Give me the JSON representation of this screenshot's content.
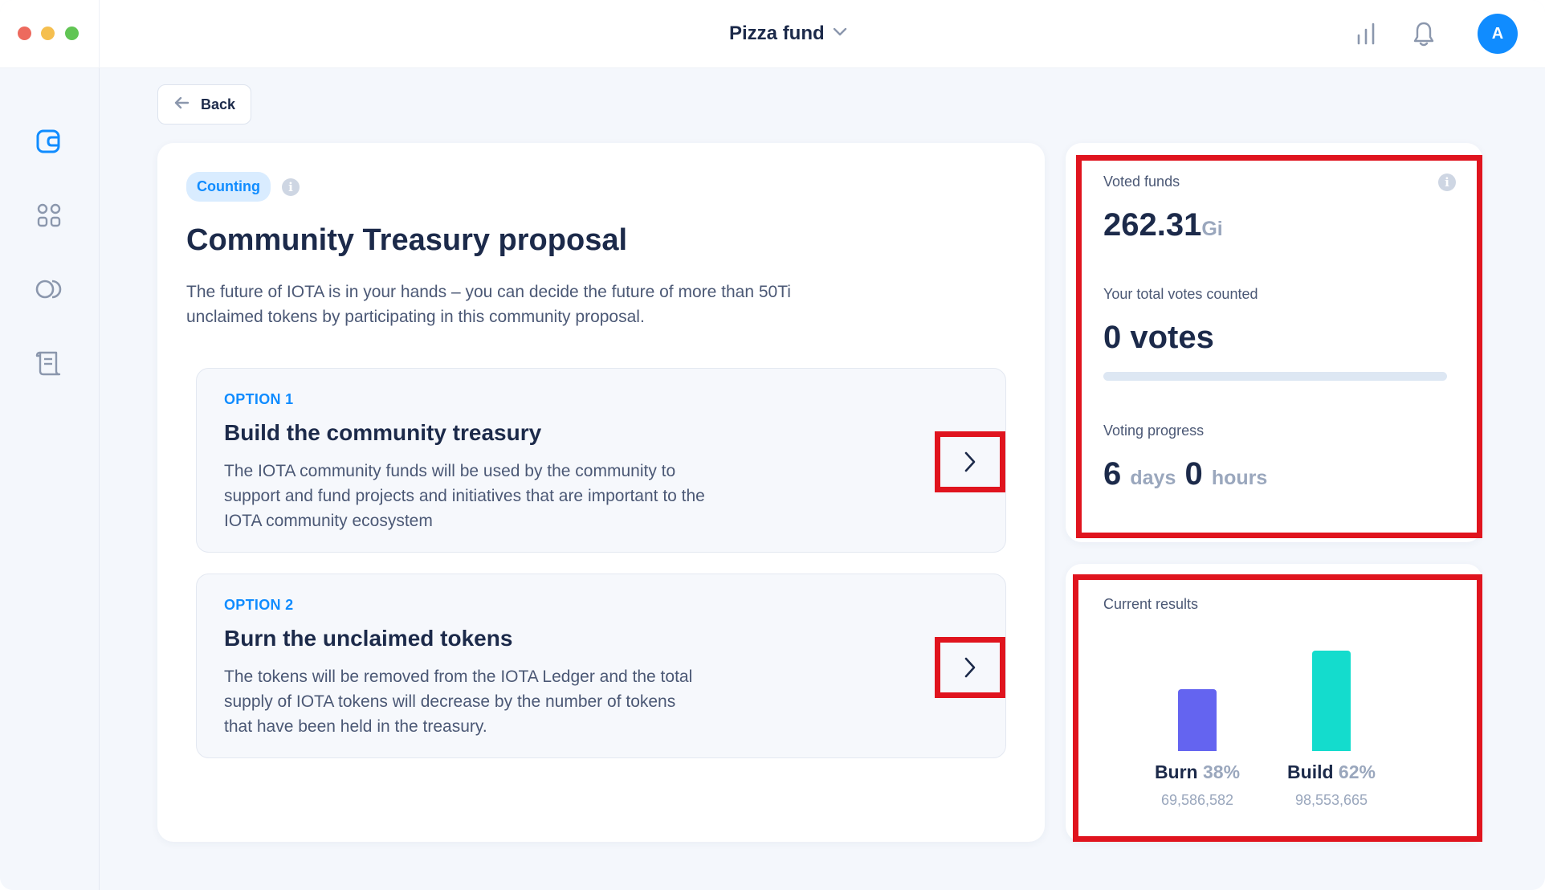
{
  "window": {
    "traffic_lights": [
      "close",
      "minimize",
      "maximize"
    ]
  },
  "header": {
    "profile_name": "Pizza fund",
    "avatar_initial": "A",
    "icons": [
      "bar-chart-icon",
      "bell-icon",
      "chevron-down-icon"
    ]
  },
  "sidebar": {
    "items": [
      {
        "icon": "wallet-icon",
        "active": true
      },
      {
        "icon": "grid-icon",
        "active": false
      },
      {
        "icon": "toggle-icon",
        "active": false
      },
      {
        "icon": "scroll-icon",
        "active": false
      }
    ]
  },
  "back": {
    "label": "Back"
  },
  "proposal": {
    "status": "Counting",
    "title": "Community Treasury proposal",
    "description": "The future of IOTA is in your hands – you can decide the future of more than 50Ti unclaimed tokens by participating in this community proposal.",
    "options": [
      {
        "label": "OPTION 1",
        "title": "Build the community treasury",
        "description": "The IOTA community funds will be used by the community to support and fund projects and initiatives that are important to the IOTA community ecosystem"
      },
      {
        "label": "OPTION 2",
        "title": "Burn the unclaimed tokens",
        "description": "The tokens will be removed from the IOTA Ledger and the total supply of IOTA tokens will decrease by the number of tokens that have been held in the treasury."
      }
    ]
  },
  "stats": {
    "voted_funds_label": "Voted funds",
    "voted_funds_value": "262.31",
    "voted_funds_unit": "Gi",
    "total_votes_label": "Your total votes counted",
    "total_votes_value": "0 votes",
    "votes_progress": 0,
    "voting_progress_label": "Voting progress",
    "days_value": "6",
    "days_unit": "days",
    "hours_value": "0",
    "hours_unit": "hours"
  },
  "results": {
    "label": "Current results",
    "items": [
      {
        "name": "Burn",
        "percent": "38%",
        "count": "69,586,582",
        "color": "#6464f0"
      },
      {
        "name": "Build",
        "percent": "62%",
        "count": "98,553,665",
        "color": "#14dccd"
      }
    ]
  },
  "colors": {
    "accent": "#108cff",
    "highlight": "#e0141e",
    "burn": "#6464f0",
    "build": "#14dccd"
  }
}
